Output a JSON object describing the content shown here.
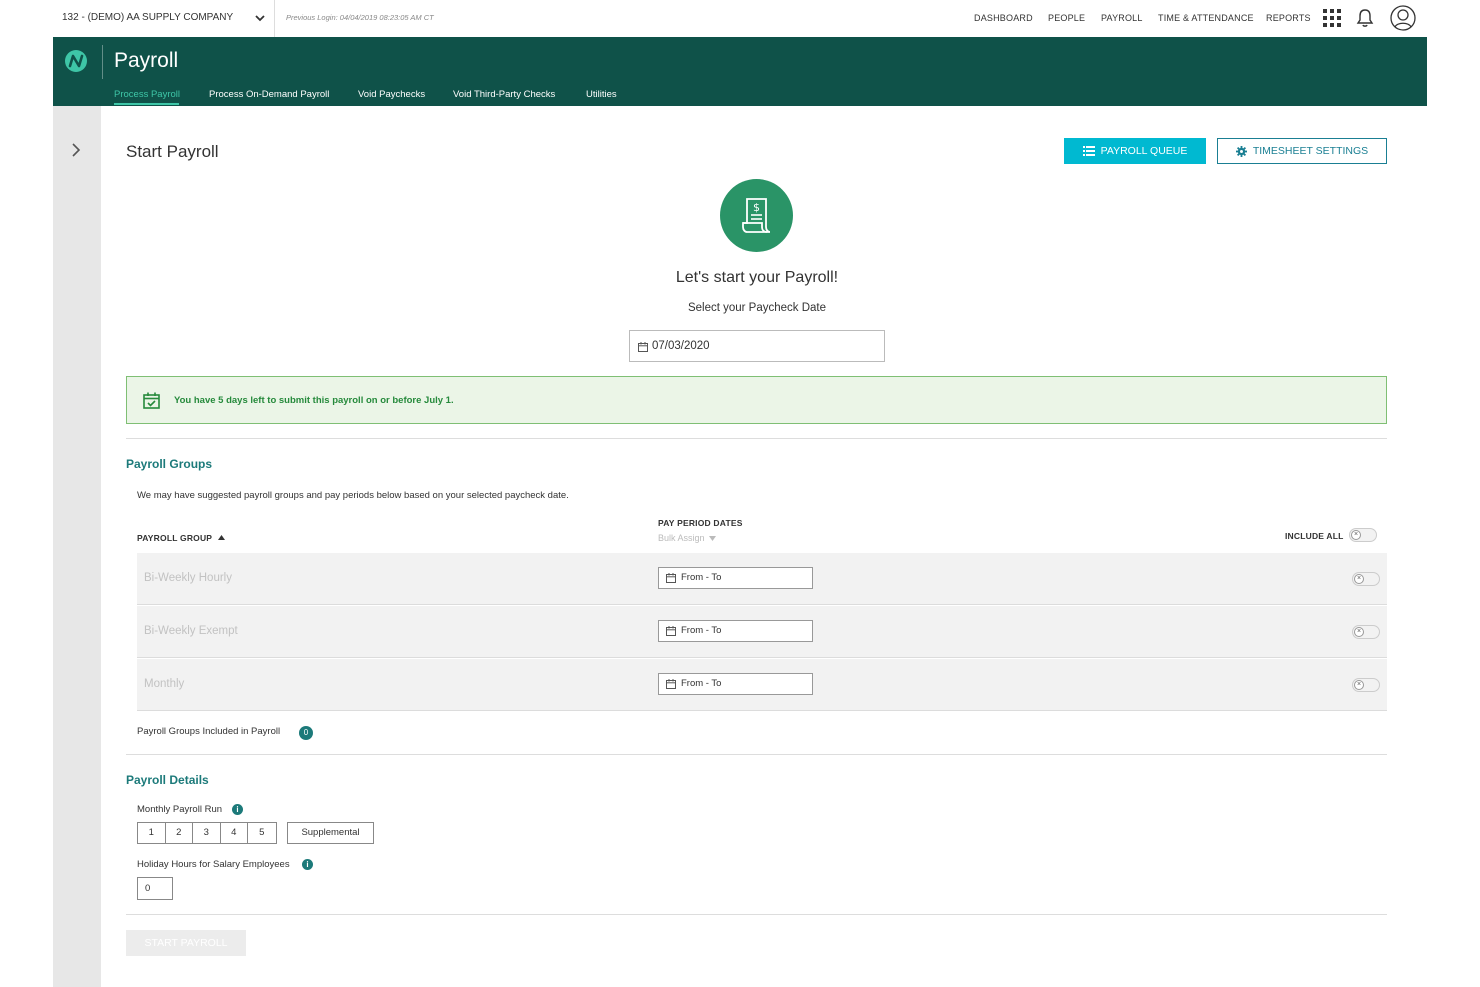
{
  "topbar": {
    "company": "132 - (DEMO) AA SUPPLY COMPANY",
    "previous_login": "Previous Login: 04/04/2019 08:23:05 AM CT",
    "nav": [
      "DASHBOARD",
      "PEOPLE",
      "PAYROLL",
      "TIME & ATTENDANCE",
      "REPORTS"
    ]
  },
  "header": {
    "title": "Payroll",
    "tabs": [
      "Process Payroll",
      "Process On-Demand Payroll",
      "Void Paychecks",
      "Void Third-Party Checks",
      "Utilities"
    ],
    "active_tab": "Process Payroll"
  },
  "main": {
    "title": "Start Payroll",
    "payroll_queue_label": "PAYROLL QUEUE",
    "timesheet_settings_label": "TIMESHEET SETTINGS",
    "hero_title": "Let's start your Payroll!",
    "hero_subtitle": "Select your Paycheck Date",
    "paycheck_date": "07/03/2020",
    "alert": "You have 5 days left to submit this payroll on or before July 1."
  },
  "groups": {
    "section_title": "Payroll Groups",
    "description": "We may have suggested payroll groups and pay periods below based on your selected paycheck date.",
    "col_group": "PAYROLL GROUP",
    "col_period": "PAY PERIOD DATES",
    "bulk_assign": "Bulk Assign",
    "include_all": "INCLUDE ALL",
    "rows": [
      {
        "name": "Bi-Weekly Hourly",
        "range": "From - To"
      },
      {
        "name": "Bi-Weekly Exempt",
        "range": "From - To"
      },
      {
        "name": "Monthly",
        "range": "From - To"
      }
    ],
    "included_label": "Payroll Groups Included in Payroll",
    "included_count": "0"
  },
  "details": {
    "section_title": "Payroll Details",
    "monthly_run_label": "Monthly Payroll Run",
    "runs": [
      "1",
      "2",
      "3",
      "4",
      "5"
    ],
    "supplemental": "Supplemental",
    "holiday_label": "Holiday Hours for Salary Employees",
    "holiday_value": "0"
  },
  "footer": {
    "start_label": "START PAYROLL"
  },
  "colors": {
    "header_bg": "#0f5249",
    "accent_teal": "#00b9d1",
    "hero_green": "#2a9467",
    "alert_bg": "#ebf5e7",
    "alert_text": "#268a3c"
  },
  "icons": [
    "chevron-down-icon",
    "apps-grid-icon",
    "bell-icon",
    "avatar-icon",
    "logo-icon",
    "chevron-right-icon",
    "list-icon",
    "gear-icon",
    "receipt-icon",
    "calendar-icon",
    "calendar-check-icon",
    "info-icon",
    "sort-up-icon"
  ]
}
